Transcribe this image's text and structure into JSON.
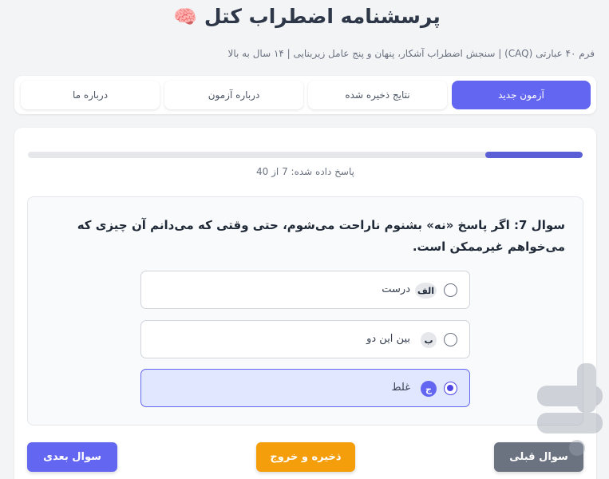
{
  "app": {
    "title": "پرسشنامه اضطراب کتل",
    "title_icon": "🧠",
    "subtitle": "فرم ۴۰ عبارتی (CAQ) | سنجش اضطراب آشکار، پنهان و پنج عامل زیربنایی | ۱۴ سال به بالا"
  },
  "tabs": [
    {
      "label": "آزمون جدید",
      "active": true
    },
    {
      "label": "نتایج ذخیره شده",
      "active": false
    },
    {
      "label": "درباره آزمون",
      "active": false
    },
    {
      "label": "درباره ما",
      "active": false
    }
  ],
  "progress": {
    "text": "پاسخ داده شده: 7 از 40",
    "answered": 7,
    "total": 40,
    "fraction": 0.175
  },
  "question": {
    "text": "سوال 7: اگر پاسخ «نه» بشنوم ناراحت می‌شوم، حتی وقتی که می‌دانم آن چیزی که می‌خواهم غیرممکن است."
  },
  "options": [
    {
      "badge": "الف",
      "label": "درست",
      "selected": false
    },
    {
      "badge": "ب",
      "label": "بین این دو",
      "selected": false
    },
    {
      "badge": "ج",
      "label": "غلط",
      "selected": true
    }
  ],
  "buttons": {
    "prev": "سوال قبلی",
    "save": "ذخیره و خروج",
    "next": "سوال بعدی"
  },
  "colors": {
    "accent": "#6366f1",
    "save": "#f59e0b",
    "prev": "#6b7280"
  }
}
